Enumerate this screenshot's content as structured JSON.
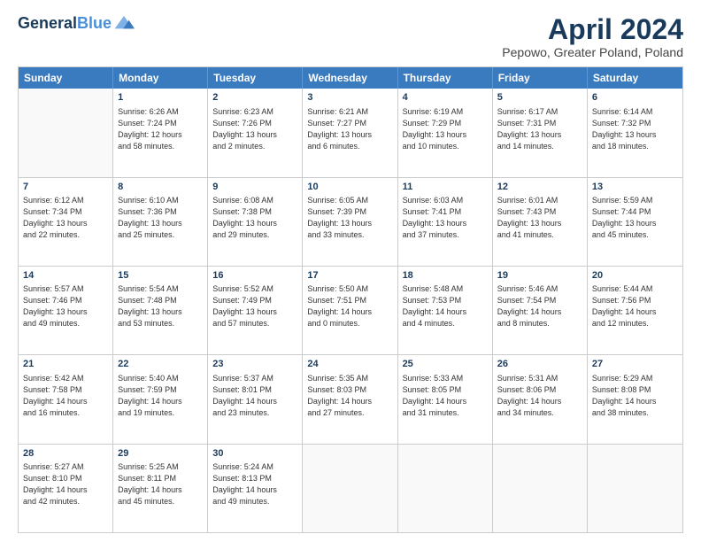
{
  "logo": {
    "line1": "General",
    "line2": "Blue"
  },
  "title": "April 2024",
  "subtitle": "Pepowo, Greater Poland, Poland",
  "days": [
    "Sunday",
    "Monday",
    "Tuesday",
    "Wednesday",
    "Thursday",
    "Friday",
    "Saturday"
  ],
  "weeks": [
    [
      {
        "day": "",
        "info": ""
      },
      {
        "day": "1",
        "info": "Sunrise: 6:26 AM\nSunset: 7:24 PM\nDaylight: 12 hours\nand 58 minutes."
      },
      {
        "day": "2",
        "info": "Sunrise: 6:23 AM\nSunset: 7:26 PM\nDaylight: 13 hours\nand 2 minutes."
      },
      {
        "day": "3",
        "info": "Sunrise: 6:21 AM\nSunset: 7:27 PM\nDaylight: 13 hours\nand 6 minutes."
      },
      {
        "day": "4",
        "info": "Sunrise: 6:19 AM\nSunset: 7:29 PM\nDaylight: 13 hours\nand 10 minutes."
      },
      {
        "day": "5",
        "info": "Sunrise: 6:17 AM\nSunset: 7:31 PM\nDaylight: 13 hours\nand 14 minutes."
      },
      {
        "day": "6",
        "info": "Sunrise: 6:14 AM\nSunset: 7:32 PM\nDaylight: 13 hours\nand 18 minutes."
      }
    ],
    [
      {
        "day": "7",
        "info": "Sunrise: 6:12 AM\nSunset: 7:34 PM\nDaylight: 13 hours\nand 22 minutes."
      },
      {
        "day": "8",
        "info": "Sunrise: 6:10 AM\nSunset: 7:36 PM\nDaylight: 13 hours\nand 25 minutes."
      },
      {
        "day": "9",
        "info": "Sunrise: 6:08 AM\nSunset: 7:38 PM\nDaylight: 13 hours\nand 29 minutes."
      },
      {
        "day": "10",
        "info": "Sunrise: 6:05 AM\nSunset: 7:39 PM\nDaylight: 13 hours\nand 33 minutes."
      },
      {
        "day": "11",
        "info": "Sunrise: 6:03 AM\nSunset: 7:41 PM\nDaylight: 13 hours\nand 37 minutes."
      },
      {
        "day": "12",
        "info": "Sunrise: 6:01 AM\nSunset: 7:43 PM\nDaylight: 13 hours\nand 41 minutes."
      },
      {
        "day": "13",
        "info": "Sunrise: 5:59 AM\nSunset: 7:44 PM\nDaylight: 13 hours\nand 45 minutes."
      }
    ],
    [
      {
        "day": "14",
        "info": "Sunrise: 5:57 AM\nSunset: 7:46 PM\nDaylight: 13 hours\nand 49 minutes."
      },
      {
        "day": "15",
        "info": "Sunrise: 5:54 AM\nSunset: 7:48 PM\nDaylight: 13 hours\nand 53 minutes."
      },
      {
        "day": "16",
        "info": "Sunrise: 5:52 AM\nSunset: 7:49 PM\nDaylight: 13 hours\nand 57 minutes."
      },
      {
        "day": "17",
        "info": "Sunrise: 5:50 AM\nSunset: 7:51 PM\nDaylight: 14 hours\nand 0 minutes."
      },
      {
        "day": "18",
        "info": "Sunrise: 5:48 AM\nSunset: 7:53 PM\nDaylight: 14 hours\nand 4 minutes."
      },
      {
        "day": "19",
        "info": "Sunrise: 5:46 AM\nSunset: 7:54 PM\nDaylight: 14 hours\nand 8 minutes."
      },
      {
        "day": "20",
        "info": "Sunrise: 5:44 AM\nSunset: 7:56 PM\nDaylight: 14 hours\nand 12 minutes."
      }
    ],
    [
      {
        "day": "21",
        "info": "Sunrise: 5:42 AM\nSunset: 7:58 PM\nDaylight: 14 hours\nand 16 minutes."
      },
      {
        "day": "22",
        "info": "Sunrise: 5:40 AM\nSunset: 7:59 PM\nDaylight: 14 hours\nand 19 minutes."
      },
      {
        "day": "23",
        "info": "Sunrise: 5:37 AM\nSunset: 8:01 PM\nDaylight: 14 hours\nand 23 minutes."
      },
      {
        "day": "24",
        "info": "Sunrise: 5:35 AM\nSunset: 8:03 PM\nDaylight: 14 hours\nand 27 minutes."
      },
      {
        "day": "25",
        "info": "Sunrise: 5:33 AM\nSunset: 8:05 PM\nDaylight: 14 hours\nand 31 minutes."
      },
      {
        "day": "26",
        "info": "Sunrise: 5:31 AM\nSunset: 8:06 PM\nDaylight: 14 hours\nand 34 minutes."
      },
      {
        "day": "27",
        "info": "Sunrise: 5:29 AM\nSunset: 8:08 PM\nDaylight: 14 hours\nand 38 minutes."
      }
    ],
    [
      {
        "day": "28",
        "info": "Sunrise: 5:27 AM\nSunset: 8:10 PM\nDaylight: 14 hours\nand 42 minutes."
      },
      {
        "day": "29",
        "info": "Sunrise: 5:25 AM\nSunset: 8:11 PM\nDaylight: 14 hours\nand 45 minutes."
      },
      {
        "day": "30",
        "info": "Sunrise: 5:24 AM\nSunset: 8:13 PM\nDaylight: 14 hours\nand 49 minutes."
      },
      {
        "day": "",
        "info": ""
      },
      {
        "day": "",
        "info": ""
      },
      {
        "day": "",
        "info": ""
      },
      {
        "day": "",
        "info": ""
      }
    ]
  ]
}
